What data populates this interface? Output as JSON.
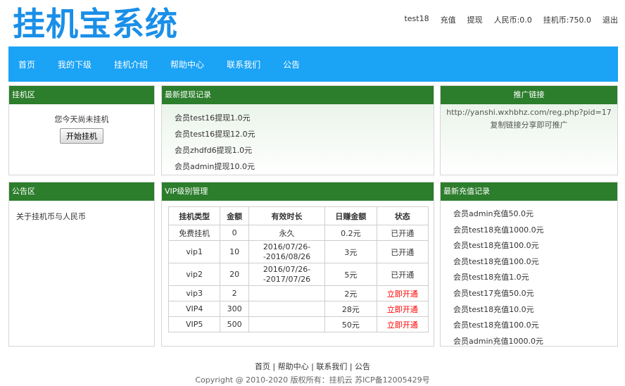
{
  "header": {
    "logo": "挂机宝系统",
    "username": "test18",
    "recharge": "充值",
    "withdraw": "提现",
    "rmb": "人民币:0.0",
    "coins": "挂机币:750.0",
    "logout": "退出"
  },
  "nav": [
    "首页",
    "我的下级",
    "挂机介绍",
    "帮助中心",
    "联系我们",
    "公告"
  ],
  "hangup": {
    "title": "挂机区",
    "message": "您今天尚未挂机",
    "button": "开始挂机"
  },
  "withdraw_records": {
    "title": "最新提现记录",
    "items": [
      "会员test16提现1.0元",
      "会员test16提现12.0元",
      "会员zhdfd6提现1.0元",
      "会员admin提现10.0元"
    ]
  },
  "promo": {
    "title": "推广链接",
    "url": "http://yanshi.wxhbhz.com/reg.php?pid=17",
    "hint": "复制链接分享即可推广"
  },
  "announcements": {
    "title": "公告区",
    "items": [
      "关于挂机币与人民币"
    ]
  },
  "vip": {
    "title": "VIP级别管理",
    "headers": [
      "挂机类型",
      "金额",
      "有效时长",
      "日赚金额",
      "状态"
    ],
    "rows": [
      {
        "type": "免费挂机",
        "amount": "0",
        "duration1": "永久",
        "duration2": "",
        "daily": "0.2元",
        "status": "已开通",
        "active": true
      },
      {
        "type": "vip1",
        "amount": "10",
        "duration1": "2016/07/26-",
        "duration2": "-2016/08/26",
        "daily": "3元",
        "status": "已开通",
        "active": true
      },
      {
        "type": "vip2",
        "amount": "20",
        "duration1": "2016/07/26-",
        "duration2": "-2017/07/26",
        "daily": "5元",
        "status": "已开通",
        "active": true
      },
      {
        "type": "vip3",
        "amount": "2",
        "duration1": "",
        "duration2": "",
        "daily": "2元",
        "status": "立即开通",
        "active": false
      },
      {
        "type": "VIP4",
        "amount": "300",
        "duration1": "",
        "duration2": "",
        "daily": "28元",
        "status": "立即开通",
        "active": false
      },
      {
        "type": "VIP5",
        "amount": "500",
        "duration1": "",
        "duration2": "",
        "daily": "50元",
        "status": "立即开通",
        "active": false
      }
    ]
  },
  "recharge_records": {
    "title": "最新充值记录",
    "items": [
      "会员admin充值50.0元",
      "会员test18充值1000.0元",
      "会员test18充值100.0元",
      "会员test18充值100.0元",
      "会员test18充值1.0元",
      "会员test17充值50.0元",
      "会员test18充值10.0元",
      "会员test18充值100.0元",
      "会员admin充值1000.0元"
    ]
  },
  "footer": {
    "links": [
      "首页",
      "帮助中心",
      "联系我们",
      "公告"
    ],
    "copyright": "Copyright @ 2010-2020 版权所有：挂机云 苏ICP备12005429号"
  },
  "colors": {
    "logo": "#1a8fe8",
    "nav": "#1ba3f5",
    "panel_head": "#2c7d2c",
    "status_pending": "#ff0000"
  }
}
